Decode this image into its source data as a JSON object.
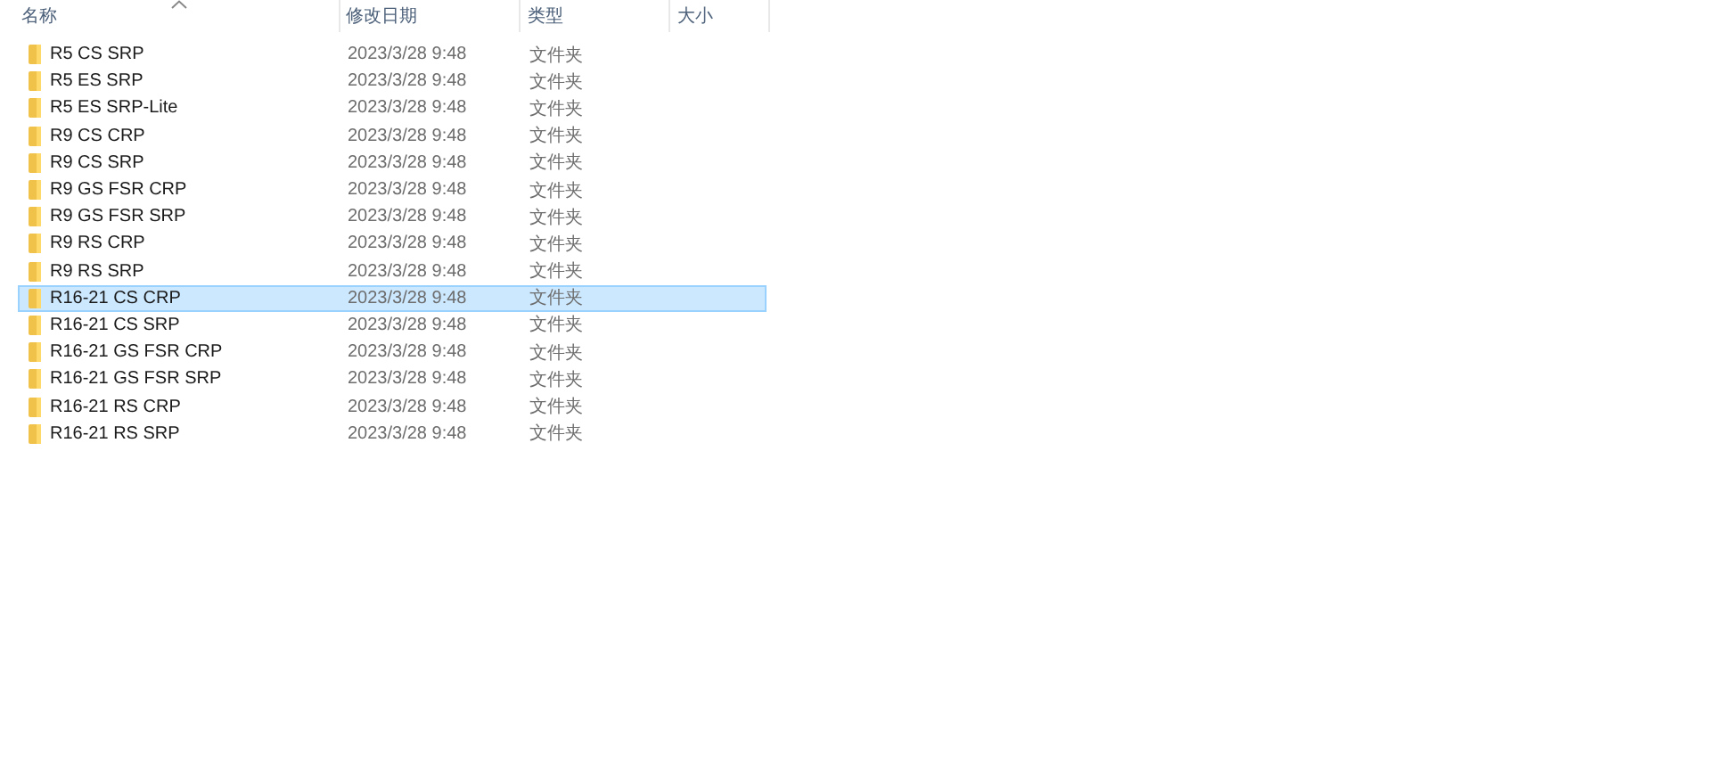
{
  "columns": [
    {
      "label": "名称",
      "sorted": true
    },
    {
      "label": "修改日期",
      "sorted": false
    },
    {
      "label": "类型",
      "sorted": false
    },
    {
      "label": "大小",
      "sorted": false
    }
  ],
  "rows": [
    {
      "name": "R5 CS SRP",
      "date": "2023/3/28 9:48",
      "type": "文件夹",
      "selected": false
    },
    {
      "name": "R5 ES SRP",
      "date": "2023/3/28 9:48",
      "type": "文件夹",
      "selected": false
    },
    {
      "name": "R5 ES SRP-Lite",
      "date": "2023/3/28 9:48",
      "type": "文件夹",
      "selected": false
    },
    {
      "name": "R9 CS CRP",
      "date": "2023/3/28 9:48",
      "type": "文件夹",
      "selected": false
    },
    {
      "name": "R9 CS SRP",
      "date": "2023/3/28 9:48",
      "type": "文件夹",
      "selected": false
    },
    {
      "name": "R9 GS FSR CRP",
      "date": "2023/3/28 9:48",
      "type": "文件夹",
      "selected": false
    },
    {
      "name": "R9 GS FSR SRP",
      "date": "2023/3/28 9:48",
      "type": "文件夹",
      "selected": false
    },
    {
      "name": "R9 RS CRP",
      "date": "2023/3/28 9:48",
      "type": "文件夹",
      "selected": false
    },
    {
      "name": "R9 RS SRP",
      "date": "2023/3/28 9:48",
      "type": "文件夹",
      "selected": false
    },
    {
      "name": "R16-21 CS CRP",
      "date": "2023/3/28 9:48",
      "type": "文件夹",
      "selected": true
    },
    {
      "name": "R16-21 CS SRP",
      "date": "2023/3/28 9:48",
      "type": "文件夹",
      "selected": false
    },
    {
      "name": "R16-21 GS FSR CRP",
      "date": "2023/3/28 9:48",
      "type": "文件夹",
      "selected": false
    },
    {
      "name": "R16-21 GS FSR SRP",
      "date": "2023/3/28 9:48",
      "type": "文件夹",
      "selected": false
    },
    {
      "name": "R16-21 RS CRP",
      "date": "2023/3/28 9:48",
      "type": "文件夹",
      "selected": false
    },
    {
      "name": "R16-21 RS SRP",
      "date": "2023/3/28 9:48",
      "type": "文件夹",
      "selected": false
    }
  ]
}
